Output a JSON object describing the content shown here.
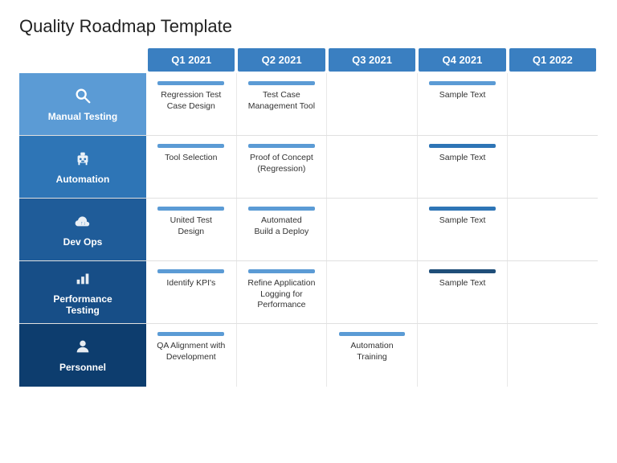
{
  "title": "Quality Roadmap Template",
  "quarters": [
    {
      "label": "Q1 2021"
    },
    {
      "label": "Q2 2021"
    },
    {
      "label": "Q3 2021"
    },
    {
      "label": "Q4 2021"
    },
    {
      "label": "Q1 2022"
    }
  ],
  "rows": [
    {
      "category": "Manual Testing",
      "icon": "🔍",
      "cat_class": "cat-light",
      "cells": [
        {
          "bar": "bar-blue",
          "text": "Regression Test\nCase Design"
        },
        {
          "bar": "bar-blue",
          "text": "Test Case\nManagement Tool"
        },
        {
          "bar": "bar-empty",
          "text": ""
        },
        {
          "bar": "bar-blue",
          "text": "Sample Text"
        },
        {
          "bar": "bar-empty",
          "text": ""
        }
      ]
    },
    {
      "category": "Automation",
      "icon": "🤖",
      "cat_class": "cat-medium",
      "cells": [
        {
          "bar": "bar-blue",
          "text": "Tool Selection"
        },
        {
          "bar": "bar-blue",
          "text": "Proof of Concept\n(Regression)"
        },
        {
          "bar": "bar-empty",
          "text": ""
        },
        {
          "bar": "bar-dark-blue",
          "text": "Sample Text"
        },
        {
          "bar": "bar-empty",
          "text": ""
        }
      ]
    },
    {
      "category": "Dev Ops",
      "icon": "☁",
      "cat_class": "cat-dark",
      "cells": [
        {
          "bar": "bar-blue",
          "text": "United Test\nDesign"
        },
        {
          "bar": "bar-blue",
          "text": "Automated\nBuild a Deploy"
        },
        {
          "bar": "bar-empty",
          "text": ""
        },
        {
          "bar": "bar-dark-blue",
          "text": "Sample Text"
        },
        {
          "bar": "bar-empty",
          "text": ""
        }
      ]
    },
    {
      "category": "Performance\nTesting",
      "icon": "📊",
      "cat_class": "cat-darker",
      "cells": [
        {
          "bar": "bar-blue",
          "text": "Identify KPI's"
        },
        {
          "bar": "bar-blue",
          "text": "Refine Application Logging for\nPerformance"
        },
        {
          "bar": "bar-empty",
          "text": ""
        },
        {
          "bar": "bar-navy",
          "text": "Sample Text"
        },
        {
          "bar": "bar-empty",
          "text": ""
        }
      ]
    },
    {
      "category": "Personnel",
      "icon": "👤",
      "cat_class": "cat-darkest",
      "cells": [
        {
          "bar": "bar-blue",
          "text": "QA Alignment with\nDevelopment"
        },
        {
          "bar": "bar-empty",
          "text": ""
        },
        {
          "bar": "bar-blue",
          "text": "Automation\nTraining"
        },
        {
          "bar": "bar-empty",
          "text": ""
        },
        {
          "bar": "bar-empty",
          "text": ""
        }
      ]
    }
  ]
}
